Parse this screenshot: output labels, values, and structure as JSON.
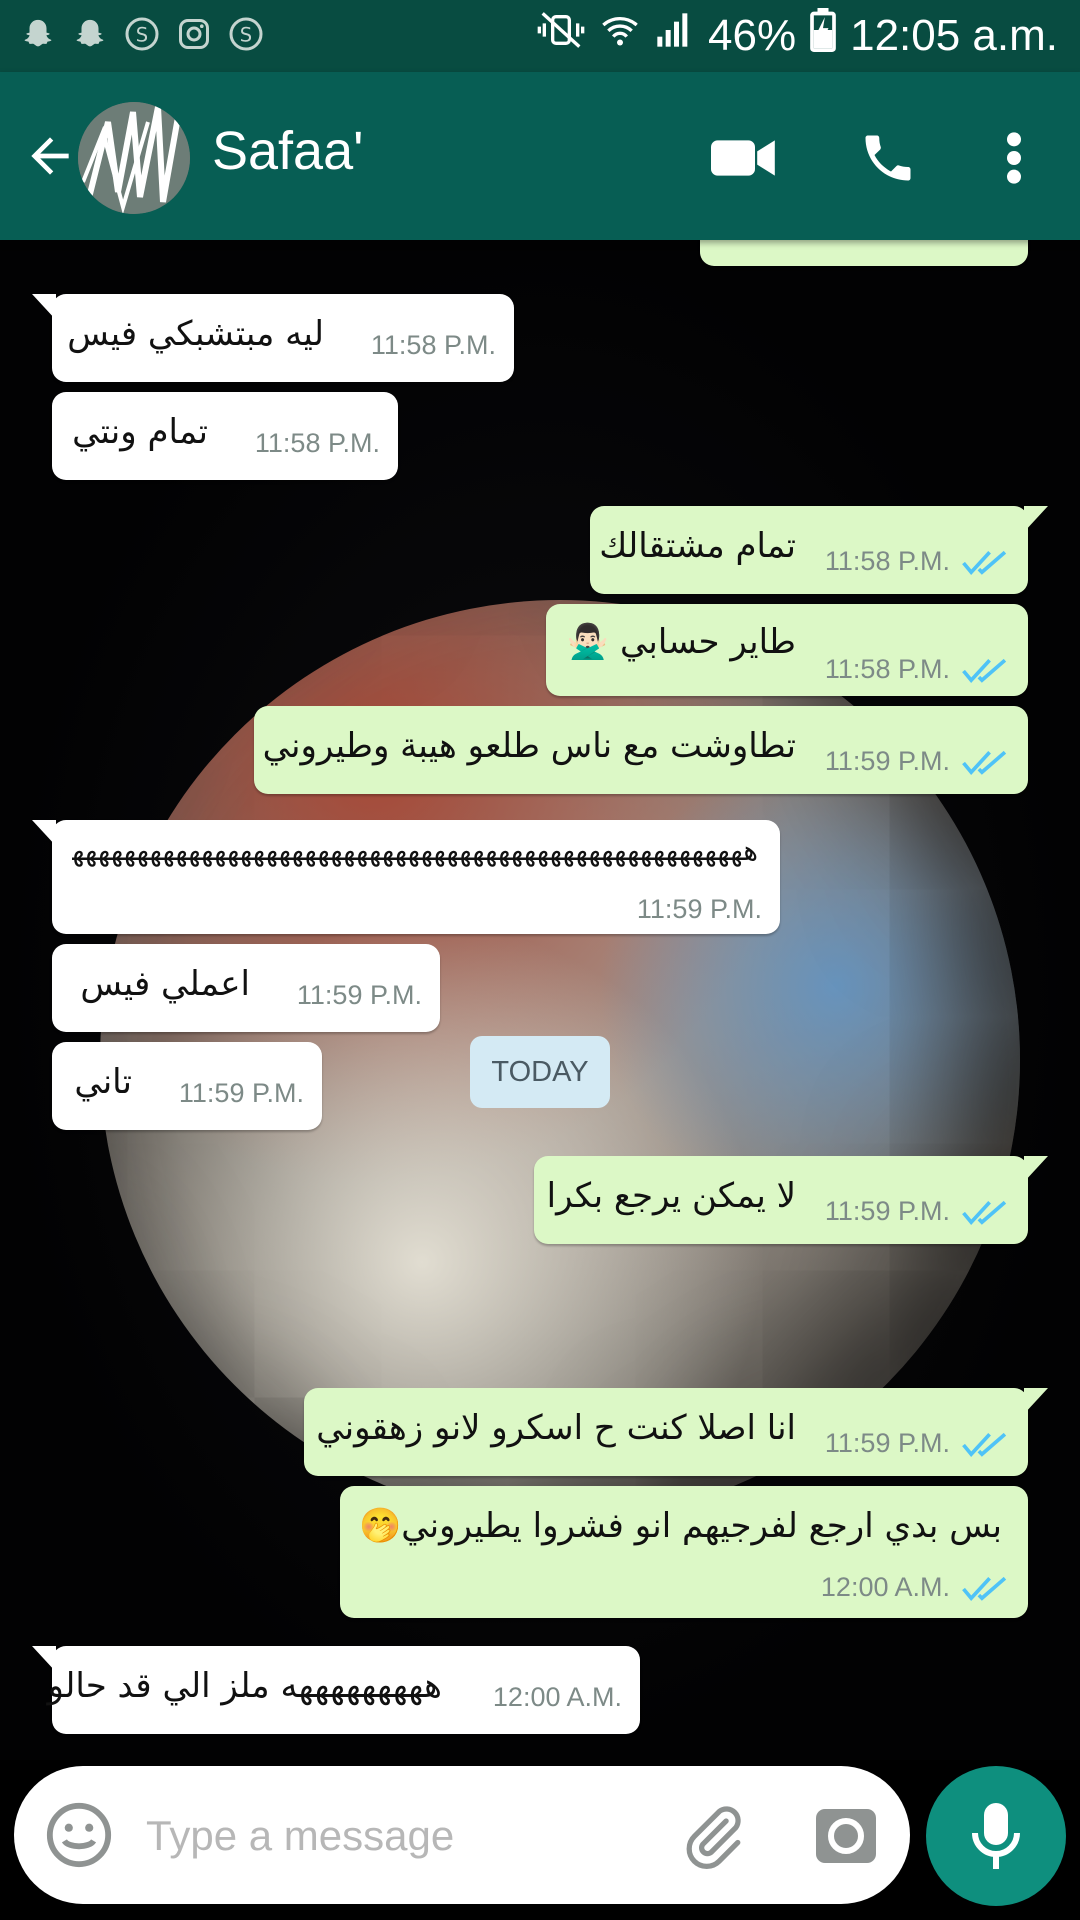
{
  "status_bar": {
    "battery": "46%",
    "time": "12:05 a.m.",
    "notification_icons": [
      "snapchat-icon",
      "snapchat-icon",
      "skype-icon",
      "instagram-icon",
      "skype-icon"
    ]
  },
  "header": {
    "contact_name": "Safaa'",
    "actions": [
      "video-call-icon",
      "voice-call-icon",
      "more-options-icon"
    ]
  },
  "messages": [
    {
      "dir": "in",
      "text": "ليه مبتشبكي فيس",
      "time": "11:58 P.M."
    },
    {
      "dir": "in",
      "text": "تمام ونتي",
      "time": "11:58 P.M."
    },
    {
      "dir": "out",
      "text": "تمام مشتقالك",
      "time": "11:58 P.M.",
      "status": "read"
    },
    {
      "dir": "out",
      "text": "طاير حسابي 🙅🏻‍♂️",
      "time": "11:58 P.M.",
      "status": "read"
    },
    {
      "dir": "out",
      "text": "تطاوشت مع ناس طلعو هيبة وطيروني",
      "time": "11:59 P.M.",
      "status": "read"
    },
    {
      "dir": "in",
      "text": "هههههههههههههههههههههههههههههههههههههههههههههههههههههه",
      "time": "11:59 P.M."
    },
    {
      "dir": "in",
      "text": "اعملي فيس",
      "time": "11:59 P.M."
    },
    {
      "dir": "in",
      "text": "تاني",
      "time": "11:59 P.M."
    },
    {
      "dir": "out",
      "text": "لا يمكن يرجع بكرا",
      "time": "11:59 P.M.",
      "status": "read"
    },
    {
      "dir": "out",
      "text": "انا اصلا كنت ح اسكرو لانو زهقوني",
      "time": "11:59 P.M.",
      "status": "read"
    },
    {
      "dir": "out",
      "text": "بس بدي ارجع لفرجيهم انو فشروا يطيروني🤭",
      "time": "12:00 A.M.",
      "status": "read"
    },
    {
      "dir": "in",
      "text": "هههههههههه ملز الي قد حالو",
      "time": "12:00 A.M."
    }
  ],
  "date_separator": "TODAY",
  "composer": {
    "placeholder": "Type a message"
  },
  "colors": {
    "header": "#075e54",
    "status_bar": "#084c41",
    "outgoing_bubble": "#dcf8c6",
    "incoming_bubble": "#ffffff",
    "mic_button": "#0e8f7e",
    "read_ticks": "#4fc3f7"
  }
}
